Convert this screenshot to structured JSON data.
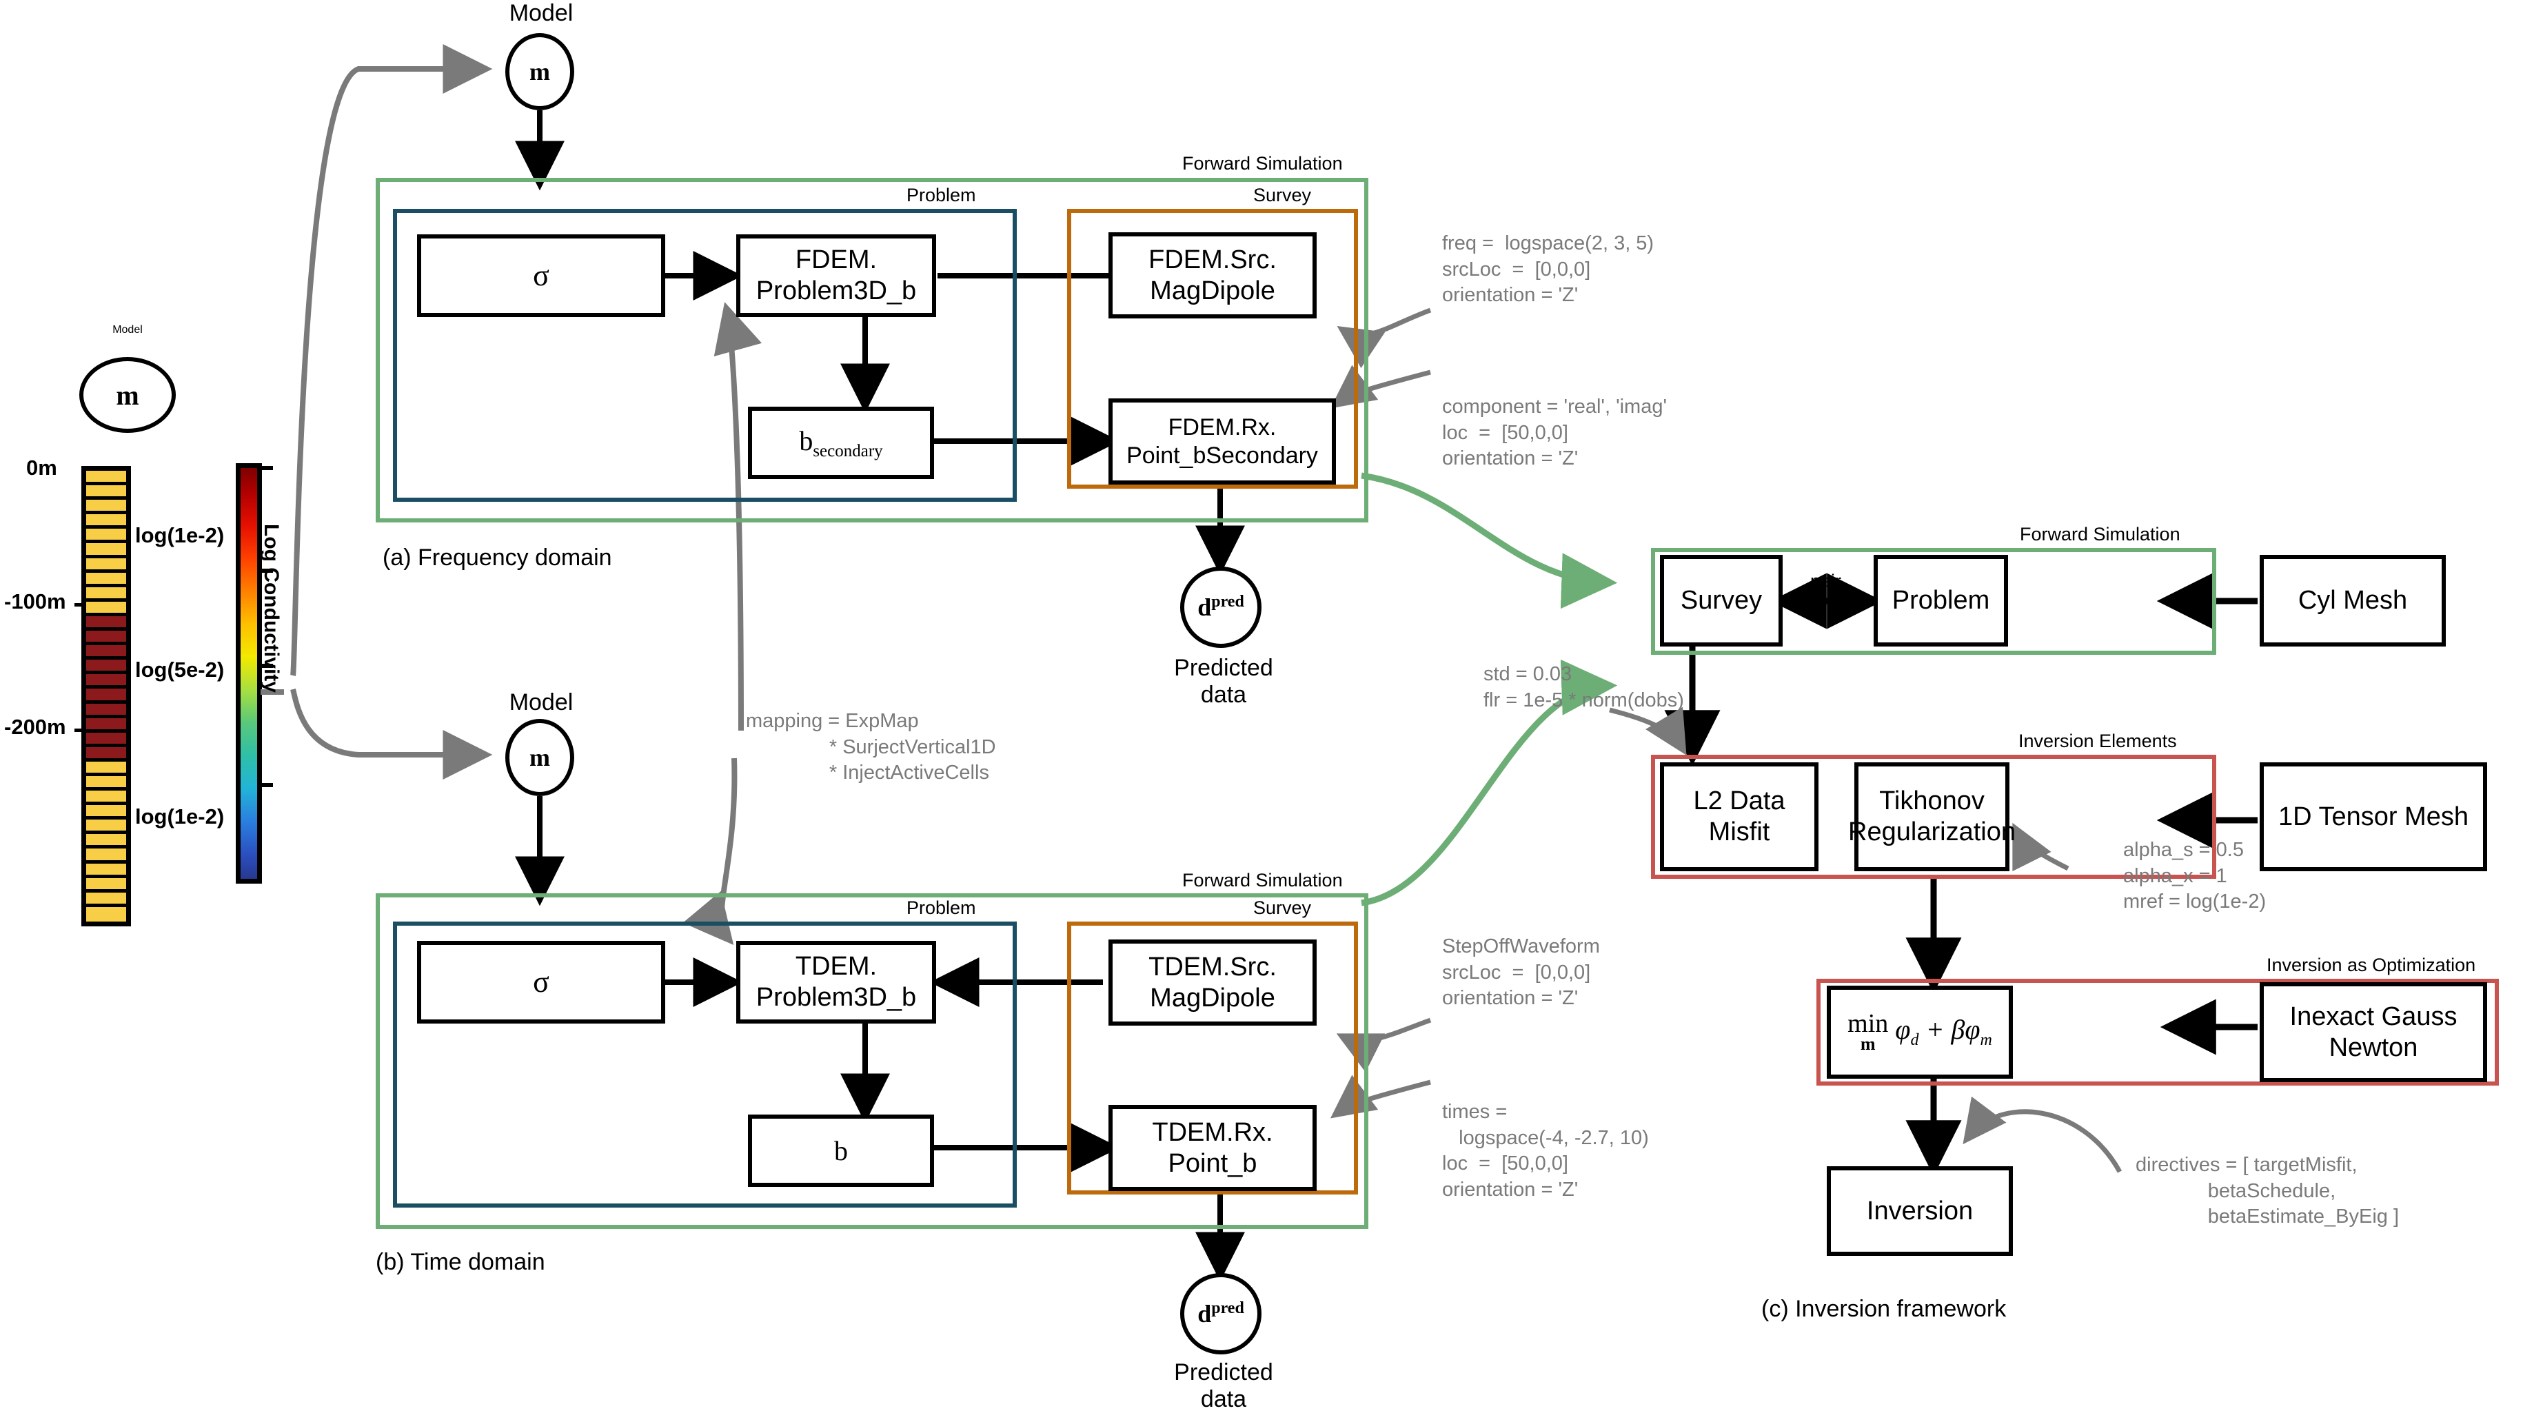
{
  "model_figure": {
    "title": "Model",
    "node_symbol": "m",
    "depth_ticks": [
      "0m",
      "-100m",
      "-200m"
    ],
    "layer_labels": [
      "log(1e-2)",
      "log(5e-2)",
      "log(1e-2)"
    ],
    "colorbar_title": "Log Conductivity",
    "colors": {
      "background_layer": "#F7CE46",
      "target_layer": "#8C1A1C"
    }
  },
  "panel_a": {
    "caption": "(a) Frequency domain",
    "model_title": "Model",
    "model_symbol": "m",
    "group_forward": "Forward Simulation",
    "group_problem": "Problem",
    "group_survey": "Survey",
    "boxes": {
      "sigma": "σ",
      "problem3d": "FDEM.\nProblem3D_b",
      "field": "b",
      "field_sub": "secondary",
      "src": "FDEM.Src.\nMagDipole",
      "rx": "FDEM.Rx.\nPoint_bSecondary"
    },
    "output": {
      "symbol": "d",
      "superscript": "pred",
      "caption": "Predicted\ndata"
    },
    "annot_src": "freq =  logspace(2, 3, 5)\nsrcLoc  =  [0,0,0]\norientation = 'Z'",
    "annot_rx": "component = 'real', 'imag'\nloc  =  [50,0,0]\norientation = 'Z'"
  },
  "panel_b": {
    "caption": "(b) Time domain",
    "model_title": "Model",
    "model_symbol": "m",
    "group_forward": "Forward Simulation",
    "group_problem": "Problem",
    "group_survey": "Survey",
    "boxes": {
      "sigma": "σ",
      "problem3d": "TDEM.\nProblem3D_b",
      "field": "b",
      "src": "TDEM.Src.\nMagDipole",
      "rx": "TDEM.Rx.\nPoint_b"
    },
    "output": {
      "symbol": "d",
      "superscript": "pred",
      "caption": "Predicted\ndata"
    },
    "annot_src": "StepOffWaveform\nsrcLoc  =  [0,0,0]\norientation = 'Z'",
    "annot_rx": "times =\n   logspace(-4, -2.7, 10)\nloc  =  [50,0,0]\norientation = 'Z'"
  },
  "mapping_annotation": "mapping = ExpMap\n               * SurjectVertical1D\n               * InjectActiveCells",
  "panel_c": {
    "caption": "(c) Inversion framework",
    "group_forward": "Forward Simulation",
    "group_inversion_elements": "Inversion Elements",
    "group_inversion_optimization": "Inversion as Optimization",
    "boxes": {
      "survey": "Survey",
      "problem": "Problem",
      "cyl_mesh": "Cyl Mesh",
      "l2_data_misfit": "L2 Data Misfit",
      "tikhonov": "Tikhonov\nRegularization",
      "tensor_mesh": "1D Tensor Mesh",
      "objective": "min φ_d + βφ_m",
      "gauss_newton": "Inexact Gauss\nNewton",
      "inversion": "Inversion"
    },
    "pair_label": "pair",
    "annot_misfit": "std = 0.03\nflr = 1e-5 * norm(dobs)",
    "annot_regularization": "alpha_s = 0.5\nalpha_x = 1\nmref = log(1e-2)",
    "annot_directives": "directives = [ targetMisfit,\n             betaSchedule,\n             betaEstimate_ByEig ]"
  },
  "palette": {
    "green": "#6CAE75",
    "teal": "#1A4F63",
    "orange": "#BC6A0C",
    "red": "#C85450",
    "annotation_gray": "#7a7a7a"
  }
}
